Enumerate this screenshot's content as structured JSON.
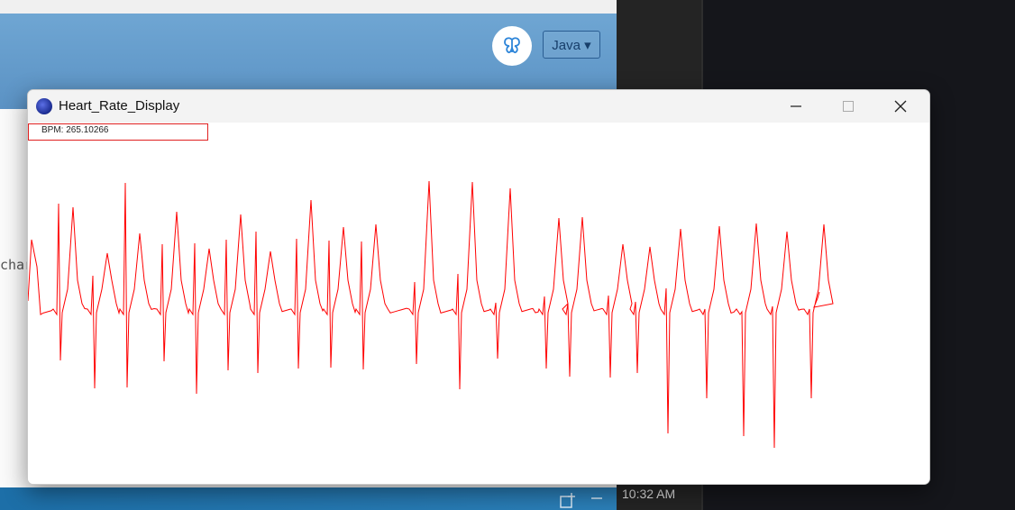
{
  "background_app": {
    "language_select": "Java ▾",
    "side_text": "char",
    "clock": "10:32 AM",
    "avatar_icon": "butterfly-icon"
  },
  "window": {
    "title": "Heart_Rate_Display",
    "app_icon": "java-app-icon",
    "controls": [
      "minimize-icon",
      "maximize-icon",
      "close-icon"
    ],
    "bpm_label": "BPM: 265.10266"
  },
  "colors": {
    "trace": "#ff0000",
    "header": "#6fa6d3",
    "bottom_bar": "#1d6fa8"
  }
}
